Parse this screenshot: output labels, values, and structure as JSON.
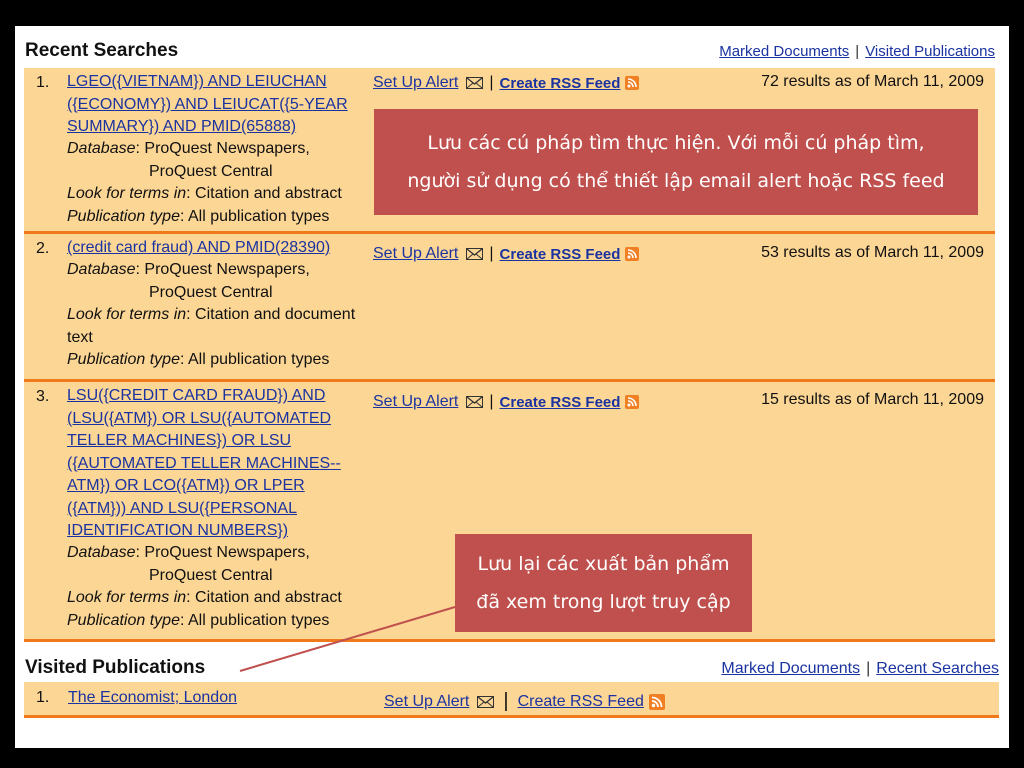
{
  "recent_searches": {
    "title": "Recent Searches",
    "links": [
      "Marked Documents",
      "Visited Publications"
    ],
    "rows": [
      {
        "number": "1.",
        "query_lines": [
          "LGEO({VIETNAM}) AND LEIUCHAN",
          "({ECONOMY}) AND LEIUCAT({5-YEAR",
          "SUMMARY}) AND PMID(65888)"
        ],
        "database_label": "Database",
        "database_lines": [
          "ProQuest Newspapers,",
          "ProQuest Central"
        ],
        "terms_label": "Look for terms in",
        "terms_lines": [
          "Citation and abstract"
        ],
        "pubtype_label": "Publication type",
        "pubtype": "All publication types",
        "alert": "Set Up Alert",
        "rss": "Create RSS Feed",
        "results": "72 results as of March 11, 2009"
      },
      {
        "number": "2.",
        "query_lines": [
          "(credit card fraud) AND PMID(28390)"
        ],
        "database_label": "Database",
        "database_lines": [
          "ProQuest Newspapers,",
          "ProQuest Central"
        ],
        "terms_label": "Look for terms in",
        "terms_lines": [
          "Citation and document",
          "text"
        ],
        "pubtype_label": "Publication type",
        "pubtype": "All publication types",
        "alert": "Set Up Alert",
        "rss": "Create RSS Feed",
        "results": "53 results as of March 11, 2009"
      },
      {
        "number": "3.",
        "query_lines": [
          "LSU({CREDIT CARD FRAUD}) AND",
          "(LSU({ATM}) OR LSU({AUTOMATED",
          "TELLER MACHINES}) OR LSU",
          "({AUTOMATED TELLER MACHINES--",
          "ATM}) OR LCO({ATM}) OR LPER",
          "({ATM})) AND LSU({PERSONAL",
          "IDENTIFICATION NUMBERS})"
        ],
        "database_label": "Database",
        "database_lines": [
          "ProQuest Newspapers,",
          "ProQuest Central"
        ],
        "terms_label": "Look for terms in",
        "terms_lines": [
          "Citation and abstract"
        ],
        "pubtype_label": "Publication type",
        "pubtype": "All publication types",
        "alert": "Set Up Alert",
        "rss": "Create RSS Feed",
        "results": "15 results as of March 11, 2009"
      }
    ]
  },
  "visited_publications": {
    "title": "Visited Publications",
    "links": [
      "Marked Documents",
      "Recent Searches"
    ],
    "rows": [
      {
        "number": "1.",
        "name": "The Economist; London",
        "alert": "Set Up Alert",
        "rss": "Create RSS Feed"
      }
    ]
  },
  "callouts": {
    "searches": [
      "Lưu các cú pháp tìm thực hiện. Với mỗi cú pháp tìm,",
      "người sử dụng có thể thiết lập email alert hoặc RSS feed"
    ],
    "publications": [
      "Lưu lại các xuất bản phẩm",
      "đã xem trong lượt truy cập"
    ]
  },
  "colors": {
    "row_bg": "#fcd695",
    "row_border": "#f07a1b",
    "link": "#1a33a0",
    "callout_bg": "#c0504d"
  }
}
